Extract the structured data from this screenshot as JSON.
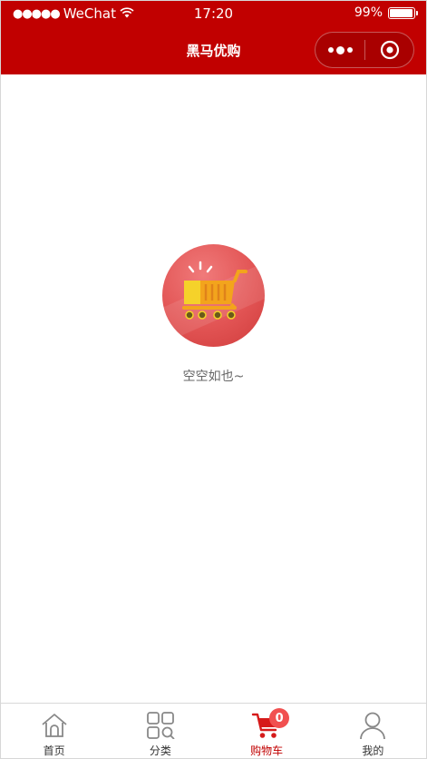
{
  "status_bar": {
    "signal_dots": "●●●●●",
    "carrier": "WeChat",
    "time": "17:20",
    "battery": "99%"
  },
  "navbar": {
    "title": "黑马优购",
    "color": "#c10000"
  },
  "empty_state": {
    "text": "空空如也~",
    "icon": "shopping-cart-icon"
  },
  "tabbar": {
    "items": [
      {
        "label": "首页",
        "icon": "home-icon",
        "active": false
      },
      {
        "label": "分类",
        "icon": "category-icon",
        "active": false
      },
      {
        "label": "购物车",
        "icon": "cart-icon",
        "active": true,
        "badge": "0"
      },
      {
        "label": "我的",
        "icon": "user-icon",
        "active": false
      }
    ]
  },
  "colors": {
    "brand": "#c10000",
    "badge": "#f15050"
  }
}
